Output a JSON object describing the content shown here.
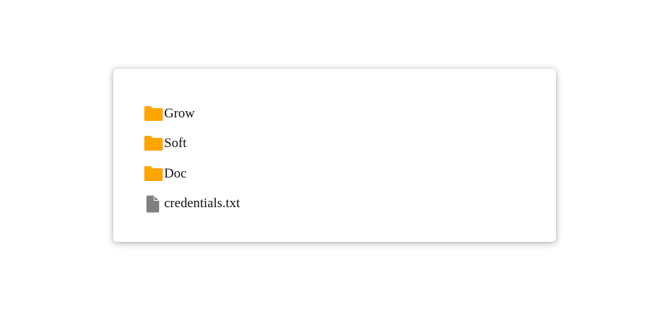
{
  "file_browser": {
    "items": [
      {
        "name": "Grow",
        "type": "folder",
        "icon": "folder-icon"
      },
      {
        "name": "Soft",
        "type": "folder",
        "icon": "folder-icon"
      },
      {
        "name": "Doc",
        "type": "folder",
        "icon": "folder-icon"
      },
      {
        "name": "credentials.txt",
        "type": "file",
        "icon": "file-icon"
      }
    ]
  },
  "colors": {
    "folder": "#FFA500",
    "file": "#808080",
    "text": "#111111",
    "panel_background": "#FFFFFF"
  }
}
